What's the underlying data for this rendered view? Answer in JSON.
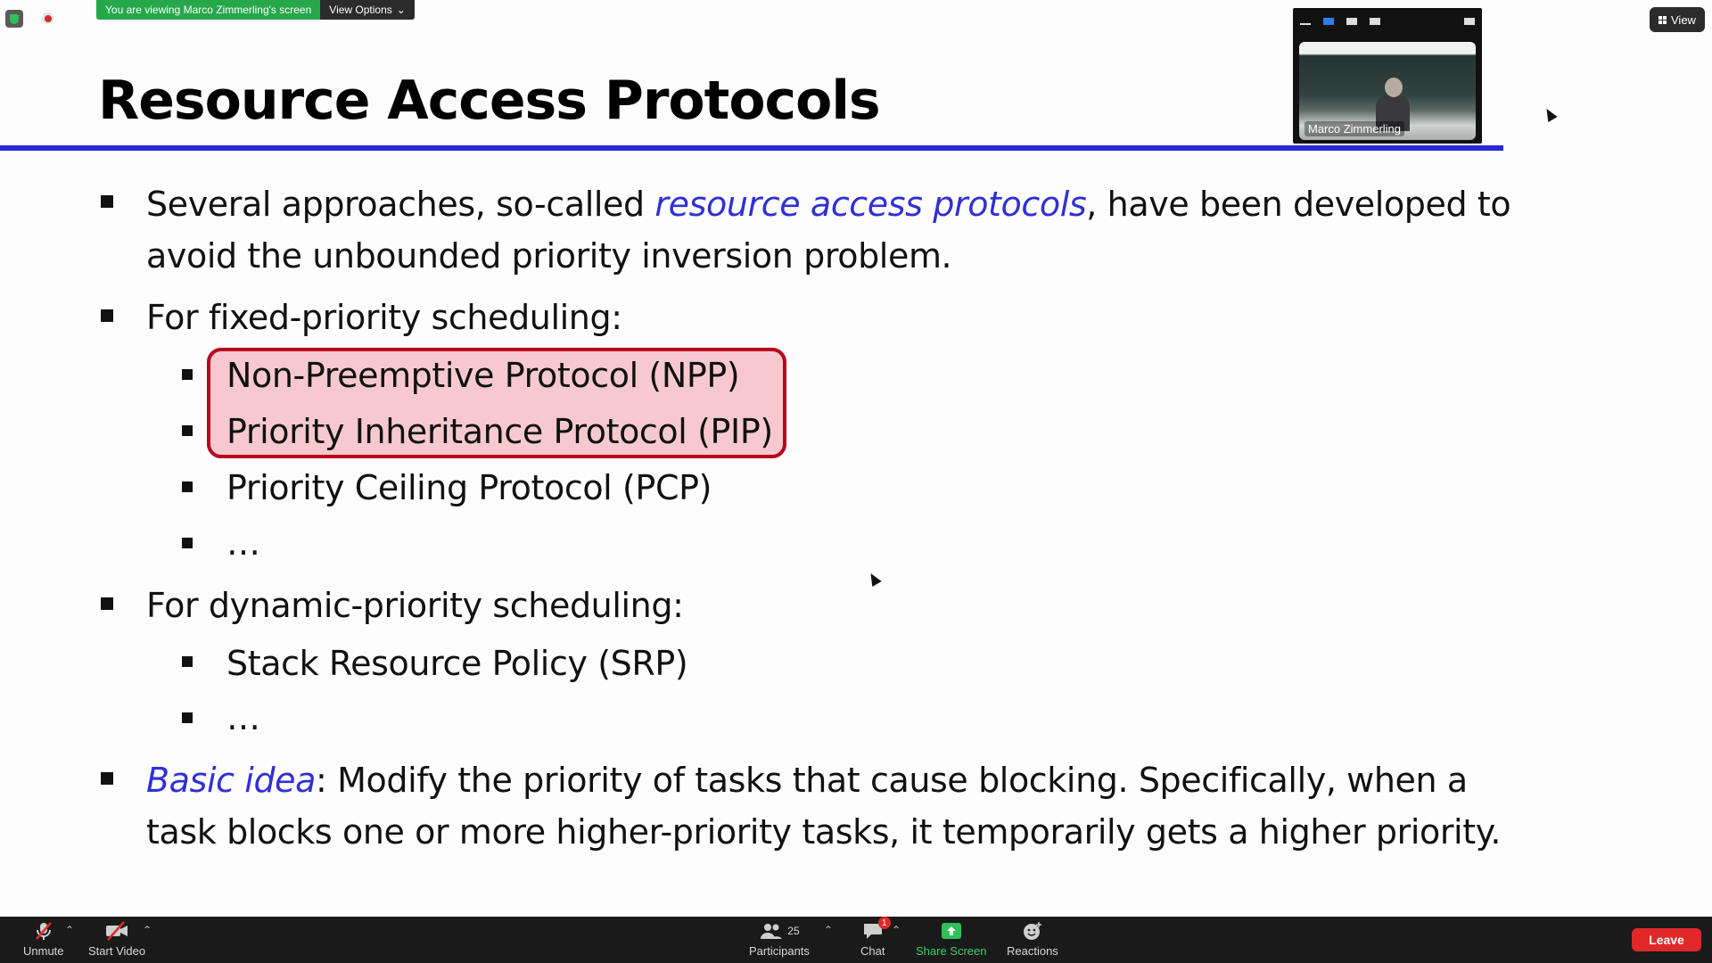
{
  "zoom": {
    "viewing_banner": "You are viewing Marco Zimmerling's screen",
    "view_options_label": "View Options",
    "view_label": "View",
    "participant_name": "Marco Zimmerling"
  },
  "slide": {
    "title": "Resource Access Protocols",
    "b1_pre": "Several approaches, so-called ",
    "b1_em": "resource access protocols",
    "b1_post": ", have been developed to",
    "b1_line2": "avoid the unbounded priority inversion problem.",
    "b2": "For fixed-priority scheduling:",
    "b2_sub": [
      "Non-Preemptive Protocol (NPP)",
      "Priority Inheritance Protocol (PIP)",
      "Priority Ceiling Protocol (PCP)",
      "…"
    ],
    "b3": "For dynamic-priority scheduling:",
    "b3_sub": [
      "Stack Resource Policy (SRP)",
      "…"
    ],
    "b4_em": "Basic idea",
    "b4_post": ": Modify the priority of tasks that cause blocking. Specifically, when a",
    "b4_line2": "task blocks one or more higher-priority tasks, it temporarily gets a higher priority."
  },
  "toolbar": {
    "unmute": "Unmute",
    "start_video": "Start Video",
    "participants": "Participants",
    "participants_count": "25",
    "chat": "Chat",
    "chat_badge": "1",
    "share_screen": "Share Screen",
    "reactions": "Reactions",
    "leave": "Leave"
  },
  "colors": {
    "accent_blue": "#2a2ad6",
    "highlight_fill": "#f7c9cf",
    "highlight_border": "#b8001f",
    "share_green": "#35d06a",
    "leave_red": "#e02828"
  }
}
